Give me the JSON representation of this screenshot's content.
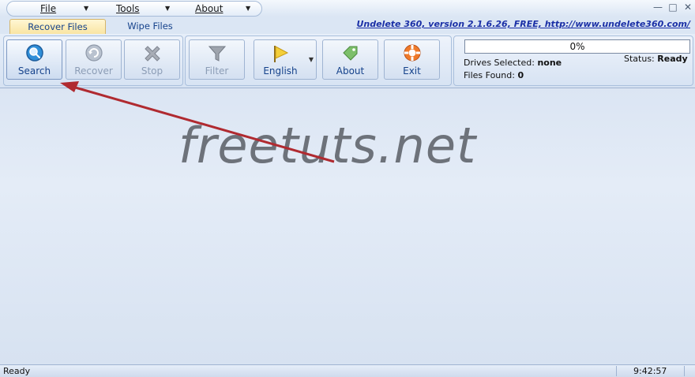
{
  "menu": {
    "file": "File",
    "tools": "Tools",
    "about": "About"
  },
  "tabs": {
    "recover": "Recover Files",
    "wipe": "Wipe Files"
  },
  "version_link": "Undelete 360, version 2.1.6.26, FREE, http://www.undelete360.com/",
  "ribbon": {
    "search": "Search",
    "recover": "Recover",
    "stop": "Stop",
    "filter": "Filter",
    "language": "English",
    "about": "About",
    "exit": "Exit"
  },
  "progress": {
    "value": 0,
    "label": "0%"
  },
  "info": {
    "drives_label": "Drives Selected:",
    "drives_value": "none",
    "files_label": "Files Found:",
    "files_value": "0",
    "status_label": "Status:",
    "status_value": "Ready"
  },
  "watermark": "freetuts.net",
  "statusbar": {
    "left": "Ready",
    "time": "9:42:57"
  },
  "colors": {
    "accent": "#15428b",
    "arrow": "#b02a30"
  },
  "icons": {
    "search": "magnifier-icon",
    "recover": "recover-icon",
    "stop": "stop-x-icon",
    "filter": "funnel-icon",
    "language": "flag-icon",
    "about": "tag-icon",
    "exit": "lifebuoy-icon"
  }
}
